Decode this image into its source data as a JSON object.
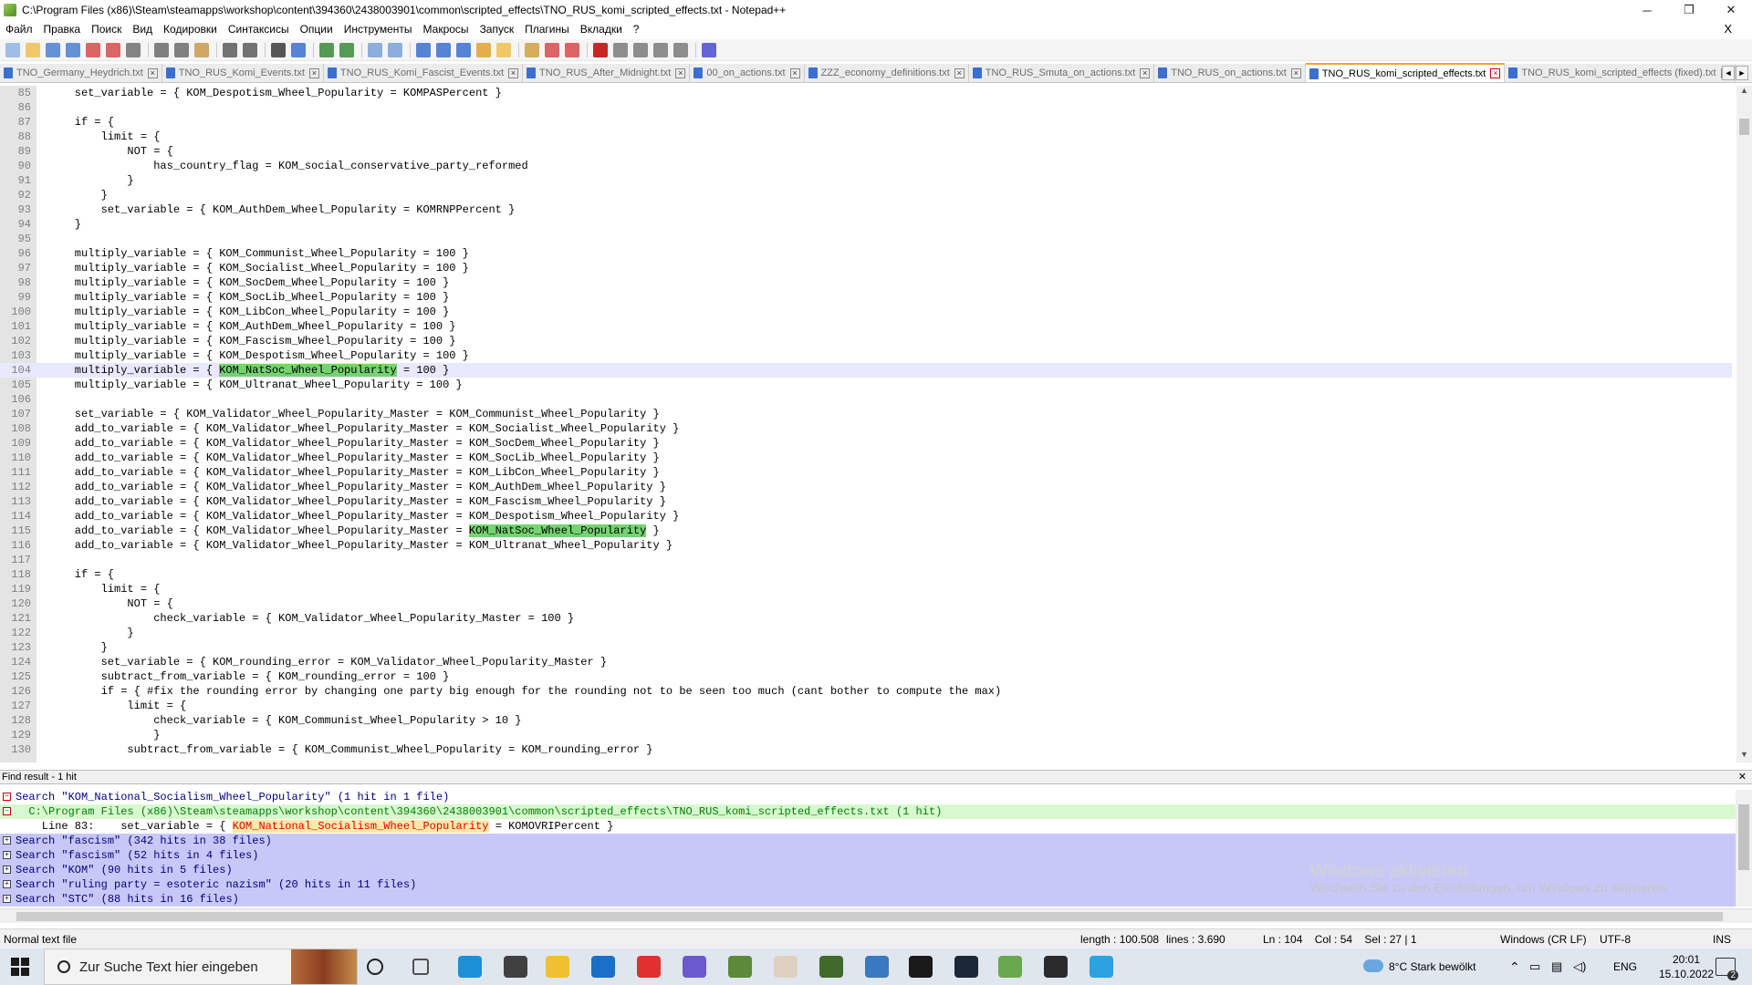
{
  "window": {
    "title": "C:\\Program Files (x86)\\Steam\\steamapps\\workshop\\content\\394360\\2438003901\\common\\scripted_effects\\TNO_RUS_komi_scripted_effects.txt - Notepad++",
    "minimize_glyph": "─",
    "maximize_glyph": "❐",
    "close_glyph": "✕"
  },
  "menu": {
    "items": [
      "Файл",
      "Правка",
      "Поиск",
      "Вид",
      "Кодировки",
      "Синтаксисы",
      "Опции",
      "Инструменты",
      "Макросы",
      "Запуск",
      "Плагины",
      "Вкладки",
      "?"
    ],
    "close_glyph": "X"
  },
  "toolbar": {
    "icons": [
      "new-file-icon",
      "open-file-icon",
      "save-icon",
      "save-all-icon",
      "close-icon",
      "close-all-icon",
      "print-icon",
      "cut-icon",
      "copy-icon",
      "paste-icon",
      "undo-icon",
      "redo-icon",
      "find-icon",
      "replace-icon",
      "zoom-in-icon",
      "zoom-out-icon",
      "sync-v-icon",
      "sync-h-icon",
      "word-wrap-icon",
      "show-all-chars-icon",
      "indent-guide-icon",
      "udl-icon",
      "doc-map-icon",
      "function-list-icon",
      "folder-workspace-icon",
      "monitoring-icon",
      "record-macro-icon",
      "stop-macro-icon",
      "play-macro-icon",
      "run-macro-multiple-icon",
      "save-macro-icon",
      "spell-check-icon"
    ]
  },
  "tabs": [
    {
      "label": "TNO_Germany_Heydrich.txt",
      "active": false
    },
    {
      "label": "TNO_RUS_Komi_Events.txt",
      "active": false
    },
    {
      "label": "TNO_RUS_Komi_Fascist_Events.txt",
      "active": false
    },
    {
      "label": "TNO_RUS_After_Midnight.txt",
      "active": false
    },
    {
      "label": "00_on_actions.txt",
      "active": false
    },
    {
      "label": "ZZZ_economy_definitions.txt",
      "active": false
    },
    {
      "label": "TNO_RUS_Smuta_on_actions.txt",
      "active": false
    },
    {
      "label": "TNO_RUS_on_actions.txt",
      "active": false
    },
    {
      "label": "TNO_RUS_komi_scripted_effects.txt",
      "active": true
    },
    {
      "label": "TNO_RUS_komi_scripted_effects (fixed).txt",
      "active": false
    }
  ],
  "tab_nav": {
    "prev": "◄",
    "next": "►"
  },
  "editor": {
    "current_line": 104,
    "lines": [
      {
        "n": "85",
        "text": "    set_variable = { KOM_Despotism_Wheel_Popularity = KOMPASPercent }"
      },
      {
        "n": "86",
        "text": ""
      },
      {
        "n": "87",
        "text": "    if = {"
      },
      {
        "n": "88",
        "text": "        limit = {"
      },
      {
        "n": "89",
        "text": "            NOT = {"
      },
      {
        "n": "90",
        "text": "                has_country_flag = KOM_social_conservative_party_reformed"
      },
      {
        "n": "91",
        "text": "            }"
      },
      {
        "n": "92",
        "text": "        }"
      },
      {
        "n": "93",
        "text": "        set_variable = { KOM_AuthDem_Wheel_Popularity = KOMRNPPercent }"
      },
      {
        "n": "94",
        "text": "    }"
      },
      {
        "n": "95",
        "text": ""
      },
      {
        "n": "96",
        "text": "    multiply_variable = { KOM_Communist_Wheel_Popularity = 100 }"
      },
      {
        "n": "97",
        "text": "    multiply_variable = { KOM_Socialist_Wheel_Popularity = 100 }"
      },
      {
        "n": "98",
        "text": "    multiply_variable = { KOM_SocDem_Wheel_Popularity = 100 }"
      },
      {
        "n": "99",
        "text": "    multiply_variable = { KOM_SocLib_Wheel_Popularity = 100 }"
      },
      {
        "n": "100",
        "text": "    multiply_variable = { KOM_LibCon_Wheel_Popularity = 100 }"
      },
      {
        "n": "101",
        "text": "    multiply_variable = { KOM_AuthDem_Wheel_Popularity = 100 }"
      },
      {
        "n": "102",
        "text": "    multiply_variable = { KOM_Fascism_Wheel_Popularity = 100 }"
      },
      {
        "n": "103",
        "text": "    multiply_variable = { KOM_Despotism_Wheel_Popularity = 100 }"
      },
      {
        "n": "104",
        "pre": "    multiply_variable = { ",
        "hl": "KOM_NatSoc_Wheel_Popularity",
        "post": " = 100 }"
      },
      {
        "n": "105",
        "text": "    multiply_variable = { KOM_Ultranat_Wheel_Popularity = 100 }"
      },
      {
        "n": "106",
        "text": ""
      },
      {
        "n": "107",
        "text": "    set_variable = { KOM_Validator_Wheel_Popularity_Master = KOM_Communist_Wheel_Popularity }"
      },
      {
        "n": "108",
        "text": "    add_to_variable = { KOM_Validator_Wheel_Popularity_Master = KOM_Socialist_Wheel_Popularity }"
      },
      {
        "n": "109",
        "text": "    add_to_variable = { KOM_Validator_Wheel_Popularity_Master = KOM_SocDem_Wheel_Popularity }"
      },
      {
        "n": "110",
        "text": "    add_to_variable = { KOM_Validator_Wheel_Popularity_Master = KOM_SocLib_Wheel_Popularity }"
      },
      {
        "n": "111",
        "text": "    add_to_variable = { KOM_Validator_Wheel_Popularity_Master = KOM_LibCon_Wheel_Popularity }"
      },
      {
        "n": "112",
        "text": "    add_to_variable = { KOM_Validator_Wheel_Popularity_Master = KOM_AuthDem_Wheel_Popularity }"
      },
      {
        "n": "113",
        "text": "    add_to_variable = { KOM_Validator_Wheel_Popularity_Master = KOM_Fascism_Wheel_Popularity }"
      },
      {
        "n": "114",
        "text": "    add_to_variable = { KOM_Validator_Wheel_Popularity_Master = KOM_Despotism_Wheel_Popularity }"
      },
      {
        "n": "115",
        "pre": "    add_to_variable = { KOM_Validator_Wheel_Popularity_Master = ",
        "hl": "KOM_NatSoc_Wheel_Popularity",
        "post": " }"
      },
      {
        "n": "116",
        "text": "    add_to_variable = { KOM_Validator_Wheel_Popularity_Master = KOM_Ultranat_Wheel_Popularity }"
      },
      {
        "n": "117",
        "text": ""
      },
      {
        "n": "118",
        "text": "    if = {"
      },
      {
        "n": "119",
        "text": "        limit = {"
      },
      {
        "n": "120",
        "text": "            NOT = {"
      },
      {
        "n": "121",
        "text": "                check_variable = { KOM_Validator_Wheel_Popularity_Master = 100 }"
      },
      {
        "n": "122",
        "text": "            }"
      },
      {
        "n": "123",
        "text": "        }"
      },
      {
        "n": "124",
        "text": "        set_variable = { KOM_rounding_error = KOM_Validator_Wheel_Popularity_Master }"
      },
      {
        "n": "125",
        "text": "        subtract_from_variable = { KOM_rounding_error = 100 }"
      },
      {
        "n": "126",
        "text": "        if = { #fix the rounding error by changing one party big enough for the rounding not to be seen too much (cant bother to compute the max)"
      },
      {
        "n": "127",
        "text": "            limit = {"
      },
      {
        "n": "128",
        "text": "                check_variable = { KOM_Communist_Wheel_Popularity > 10 }"
      },
      {
        "n": "129",
        "text": "                }"
      },
      {
        "n": "130",
        "text": "            subtract_from_variable = { KOM_Communist_Wheel_Popularity = KOM_rounding_error }"
      }
    ],
    "scroll_up": "▲",
    "scroll_down": "▼"
  },
  "find_result": {
    "header": "Find result - 1 hit",
    "close_glyph": "✕",
    "rows": [
      {
        "kind": "search first",
        "toggle": "−",
        "text": "Search \"KOM_National_Socialism_Wheel_Popularity\" (1 hit in 1 file)"
      },
      {
        "kind": "file",
        "toggle": "−",
        "text": "  C:\\Program Files (x86)\\Steam\\steamapps\\workshop\\content\\394360\\2438003901\\common\\scripted_effects\\TNO_RUS_komi_scripted_effects.txt (1 hit)"
      },
      {
        "kind": "hit",
        "toggle": "",
        "pre": "    Line 83:    set_variable = { ",
        "kw": "KOM_National_Socialism_Wheel_Popularity",
        "post": " = KOMOVRIPercent }"
      },
      {
        "kind": "search",
        "toggle": "+",
        "text": "Search \"fascism\" (342 hits in 38 files)"
      },
      {
        "kind": "search",
        "toggle": "+",
        "text": "Search \"fascism\" (52 hits in 4 files)"
      },
      {
        "kind": "search",
        "toggle": "+",
        "text": "Search \"KOM\" (90 hits in 5 files)"
      },
      {
        "kind": "search",
        "toggle": "+",
        "text": "Search \"ruling party = esoteric nazism\" (20 hits in 11 files)"
      },
      {
        "kind": "search",
        "toggle": "+",
        "text": "Search \"STC\" (88 hits in 16 files)"
      }
    ]
  },
  "watermark": {
    "title": "Windows aktivieren",
    "subtitle": "Wechseln Sie zu den Einstellungen, um Windows zu aktivieren."
  },
  "status": {
    "filetype": "Normal text file",
    "length": "length : 100.508",
    "lines": "lines : 3.690",
    "position": "Ln : 104    Col : 54    Sel : 27 | 1",
    "eol": "Windows (CR LF)",
    "encoding": "UTF-8",
    "mode": "INS"
  },
  "taskbar": {
    "search_placeholder": "Zur Suche Text hier eingeben",
    "weather": "8°C  Stark bewölkt",
    "language": "ENG",
    "time": "20:01",
    "date": "15.10.2022",
    "notification_count": "2",
    "apps": [
      "cortana-icon",
      "task-view-icon",
      "edge-icon",
      "store-icon",
      "explorer-icon",
      "mail-icon",
      "yandex-browser-icon",
      "discord-icon",
      "minecraft-icon",
      "yandex-icon",
      "minecraft-launcher-icon",
      "python-icon",
      "pycharm-icon",
      "steam-icon",
      "notepadpp-icon",
      "game-icon",
      "telegram-icon"
    ]
  },
  "colors": {
    "highlight": "#73d470",
    "current_line": "#e8e8ff",
    "gutter": "#e4e4e4",
    "search_row": "#c8c8f8",
    "file_row": "#d8f8d0",
    "active_tab_accent": "#f5a623"
  }
}
